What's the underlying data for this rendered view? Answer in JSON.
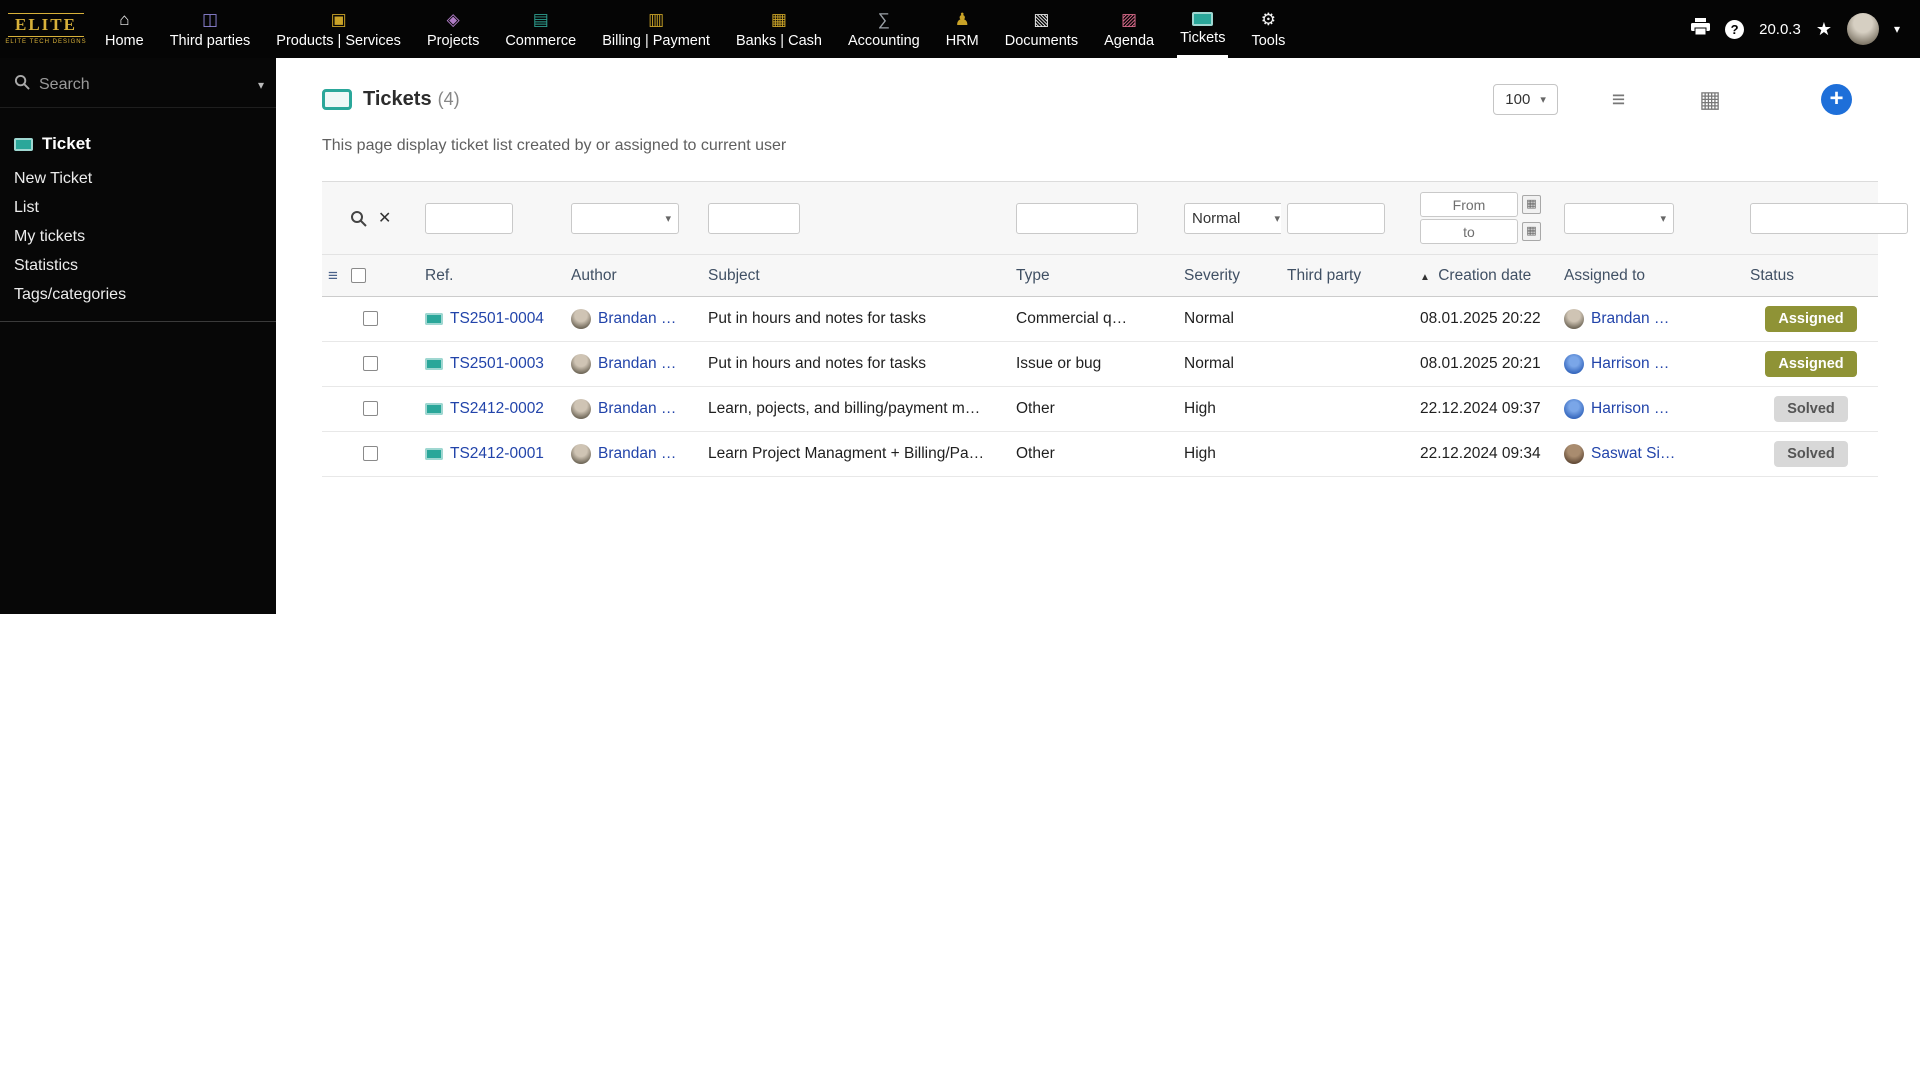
{
  "colors": {
    "accent_blue": "#1e6fd9",
    "link_blue": "#2244aa",
    "teal": "#2aa79a",
    "badge_assigned_bg": "#8f9336",
    "badge_solved_bg": "#d8d8d8",
    "topbar_bg": "#050505",
    "gold": "#d8b13a"
  },
  "icons": {
    "sort_asc": "▲",
    "clear": "✕",
    "caret": "▾",
    "chevron_down": "▾",
    "star": "★",
    "calendar": "▦",
    "view_list": "≡",
    "view_grid": "▦",
    "plus": "+",
    "help": "?",
    "list_fields": "≡"
  },
  "topbar": {
    "logo_title": "ELITE",
    "logo_subtitle": "ELITE TECH DESIGNS",
    "version": "20.0.3",
    "items": [
      {
        "id": "home",
        "label": "Home",
        "icon": "home-icon",
        "glyph": "⌂",
        "color": "#f5f5f5"
      },
      {
        "id": "third-parties",
        "label": "Third parties",
        "icon": "third-parties-icon",
        "glyph": "◫",
        "color": "#8f86d8"
      },
      {
        "id": "products-services",
        "label": "Products | Services",
        "icon": "products-icon",
        "glyph": "▣",
        "color": "#c9a227"
      },
      {
        "id": "projects",
        "label": "Projects",
        "icon": "projects-icon",
        "glyph": "◈",
        "color": "#b07cc6"
      },
      {
        "id": "commerce",
        "label": "Commerce",
        "icon": "commerce-icon",
        "glyph": "▤",
        "color": "#2e9e8f"
      },
      {
        "id": "billing-payment",
        "label": "Billing | Payment",
        "icon": "billing-icon",
        "glyph": "▥",
        "color": "#c9a227"
      },
      {
        "id": "banks-cash",
        "label": "Banks | Cash",
        "icon": "banks-icon",
        "glyph": "▦",
        "color": "#c9a227"
      },
      {
        "id": "accounting",
        "label": "Accounting",
        "icon": "accounting-icon",
        "glyph": "∑",
        "color": "#9aa0a6"
      },
      {
        "id": "hrm",
        "label": "HRM",
        "icon": "hrm-icon",
        "glyph": "♟",
        "color": "#c9a227"
      },
      {
        "id": "documents",
        "label": "Documents",
        "icon": "documents-icon",
        "glyph": "▧",
        "color": "#e8e8e8"
      },
      {
        "id": "agenda",
        "label": "Agenda",
        "icon": "agenda-icon",
        "glyph": "▨",
        "color": "#d86a8a"
      },
      {
        "id": "tickets",
        "label": "Tickets",
        "icon": "tickets-icon",
        "ticket": true,
        "active": true
      },
      {
        "id": "tools",
        "label": "Tools",
        "icon": "tools-icon",
        "glyph": "⚙",
        "color": "#f5f5f5"
      }
    ]
  },
  "sidebar": {
    "search_placeholder": "Search",
    "section_title": "Ticket",
    "items": [
      {
        "id": "new-ticket",
        "label": "New Ticket"
      },
      {
        "id": "list",
        "label": "List"
      },
      {
        "id": "my-tickets",
        "label": "My tickets"
      },
      {
        "id": "statistics",
        "label": "Statistics"
      },
      {
        "id": "tags-categories",
        "label": "Tags/categories"
      }
    ]
  },
  "main": {
    "title": "Tickets",
    "count": "(4)",
    "page_size": "100",
    "description": "This page display ticket list created by or assigned to current user"
  },
  "filters": {
    "severity_selected": "Normal",
    "date_from_label": "From",
    "date_to_label": "to"
  },
  "table": {
    "columns": [
      "Ref.",
      "Author",
      "Subject",
      "Type",
      "Severity",
      "Third party",
      "Creation date",
      "Assigned to",
      "Status"
    ],
    "sort_column": "Creation date",
    "sort_direction": "asc",
    "rows": [
      {
        "ref": "TS2501-0004",
        "author": "Brandan …",
        "author_avatar": "brandan",
        "subject": "Put in hours and notes for tasks",
        "type": "Commercial q…",
        "severity": "Normal",
        "third_party": "",
        "creation_date": "08.01.2025 20:22",
        "assigned_to": "Brandan …",
        "assigned_avatar": "brandan",
        "status": "Assigned",
        "status_kind": "assigned"
      },
      {
        "ref": "TS2501-0003",
        "author": "Brandan …",
        "author_avatar": "brandan",
        "subject": "Put in hours and notes for tasks",
        "type": "Issue or bug",
        "severity": "Normal",
        "third_party": "",
        "creation_date": "08.01.2025 20:21",
        "assigned_to": "Harrison …",
        "assigned_avatar": "harrison",
        "status": "Assigned",
        "status_kind": "assigned"
      },
      {
        "ref": "TS2412-0002",
        "author": "Brandan …",
        "author_avatar": "brandan",
        "subject": "Learn, pojects, and billing/payment m…",
        "type": "Other",
        "severity": "High",
        "third_party": "",
        "creation_date": "22.12.2024 09:37",
        "assigned_to": "Harrison …",
        "assigned_avatar": "harrison",
        "status": "Solved",
        "status_kind": "solved"
      },
      {
        "ref": "TS2412-0001",
        "author": "Brandan …",
        "author_avatar": "brandan",
        "subject": "Learn Project Managment + Billing/Pa…",
        "type": "Other",
        "severity": "High",
        "third_party": "",
        "creation_date": "22.12.2024 09:34",
        "assigned_to": "Saswat Si…",
        "assigned_avatar": "saswat",
        "status": "Solved",
        "status_kind": "solved"
      }
    ]
  }
}
